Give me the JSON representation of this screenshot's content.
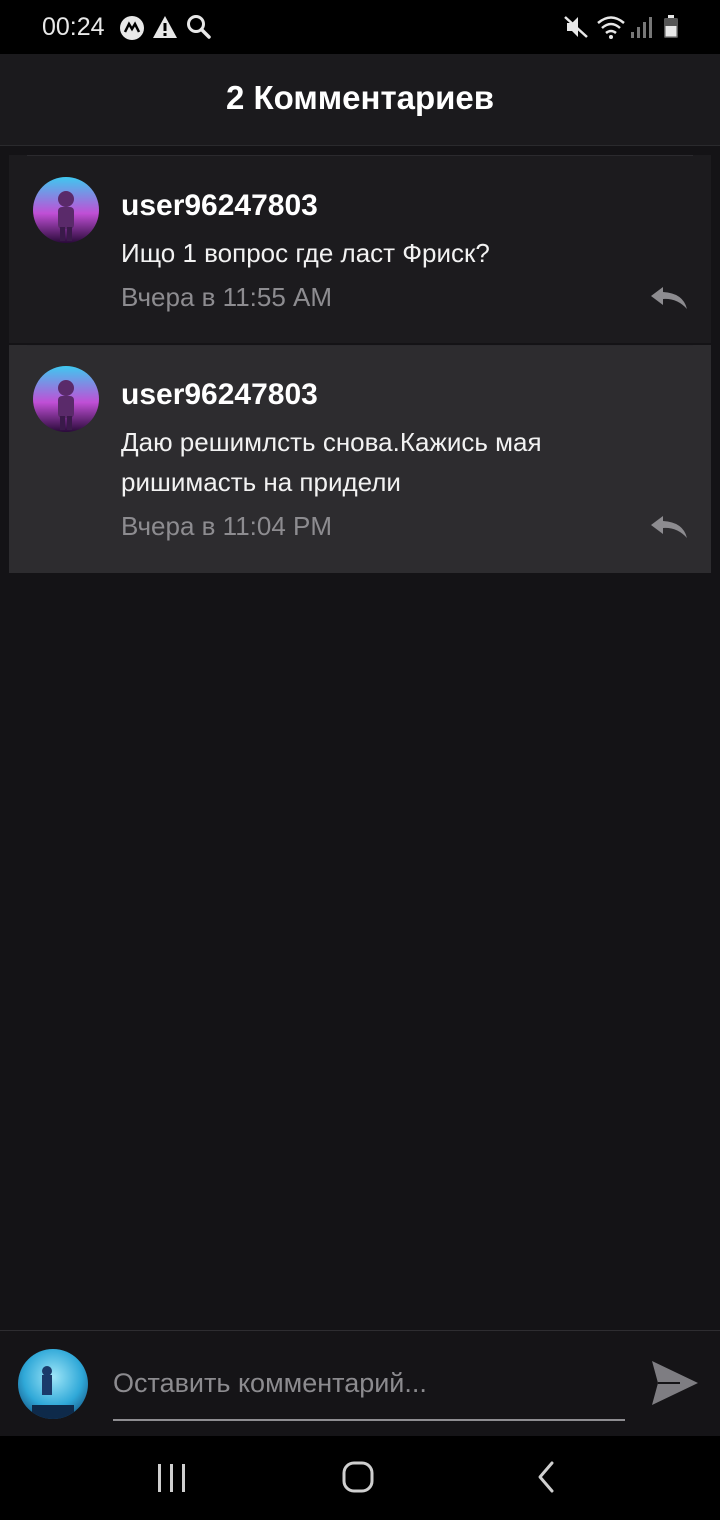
{
  "status_bar": {
    "time": "00:24",
    "icons": [
      "messenger-icon",
      "warning-icon",
      "search-icon",
      "mute-icon",
      "wifi-icon",
      "signal-icon",
      "battery-icon"
    ]
  },
  "header": {
    "title": "2 Комментариев"
  },
  "comments": [
    {
      "author": "user96247803",
      "text": "Ищо 1 вопрос где ласт Фриск?",
      "time": "Вчера в 11:55 AM",
      "avatar": "astronaut-avatar"
    },
    {
      "author": "user96247803",
      "text": "Даю решимлсть снова.Кажись мая ришимасть на придели",
      "time": "Вчера в 11:04 PM",
      "avatar": "astronaut-avatar"
    }
  ],
  "composer": {
    "placeholder": "Оставить комментарий...",
    "value": ""
  },
  "nav": {
    "buttons": [
      "recent-apps",
      "home",
      "back"
    ]
  },
  "colors": {
    "background": "#141316",
    "header": "#1b1a1d",
    "comment_bg": "#1c1b1e",
    "comment_highlight": "#2d2c2f",
    "muted_text": "#8d8c90"
  }
}
